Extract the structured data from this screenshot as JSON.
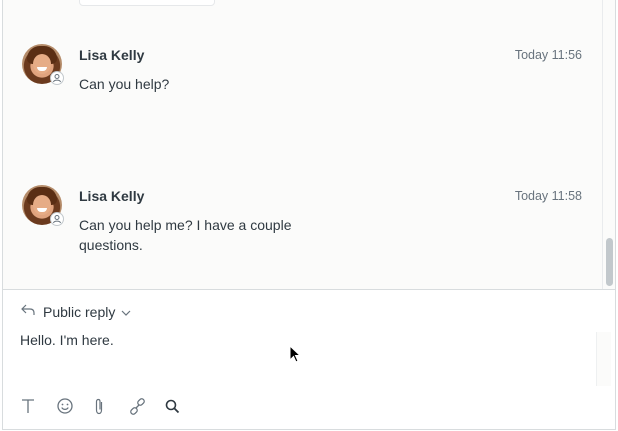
{
  "messages": [
    {
      "author": "Lisa Kelly",
      "time": "Today 11:56",
      "text": "Can you help?"
    },
    {
      "author": "Lisa Kelly",
      "time": "Today 11:58",
      "text": "Can you help me? I have a couple questions."
    }
  ],
  "reply": {
    "mode_label": "Public reply",
    "text": "Hello. I'm here."
  },
  "toolbar": {
    "icons": [
      "text-format-icon",
      "emoji-icon",
      "attachment-icon",
      "link-icon",
      "search-icon"
    ]
  }
}
